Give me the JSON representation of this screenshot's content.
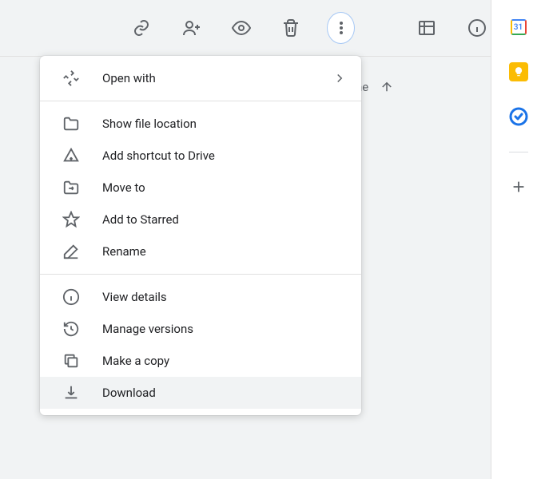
{
  "toolbar": {
    "link": "Get link",
    "share": "Share",
    "preview": "Preview",
    "trash": "Remove",
    "more": "More actions",
    "list": "List view",
    "info": "View details"
  },
  "bg": {
    "text": "ne"
  },
  "menu": {
    "open_with": "Open with",
    "show_location": "Show file location",
    "add_shortcut": "Add shortcut to Drive",
    "move_to": "Move to",
    "add_starred": "Add to Starred",
    "rename": "Rename",
    "view_details": "View details",
    "manage_versions": "Manage versions",
    "make_copy": "Make a copy",
    "download": "Download"
  },
  "side": {
    "calendar_day": "31",
    "calendar": "Calendar",
    "keep": "Keep",
    "tasks": "Tasks",
    "add": "Add"
  }
}
